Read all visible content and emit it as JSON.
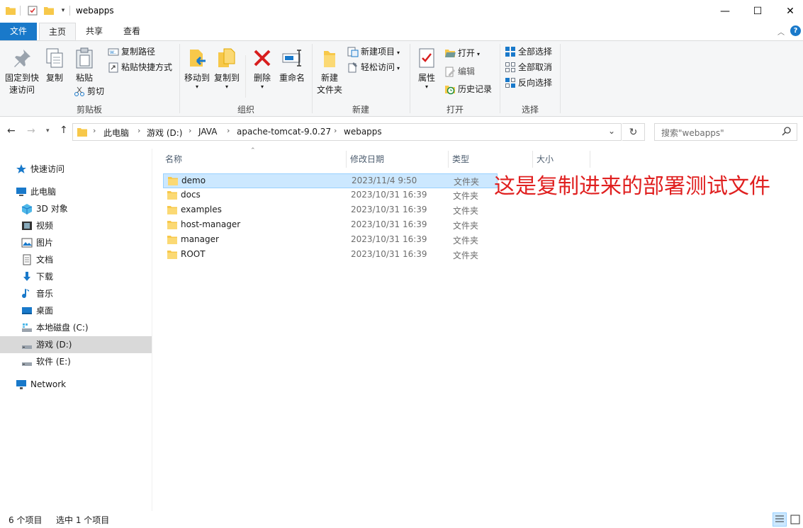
{
  "window": {
    "title": "webapps",
    "minimize_glyph": "—",
    "maximize_glyph": "☐",
    "close_glyph": "✕"
  },
  "ribbon_tabs": {
    "file": "文件",
    "home": "主页",
    "share": "共享",
    "view": "查看"
  },
  "ribbon": {
    "clipboard": {
      "pin": "固定到快",
      "pin2": "速访问",
      "copy": "复制",
      "paste": "粘贴",
      "copy_path": "复制路径",
      "paste_shortcut": "粘贴快捷方式",
      "cut": "剪切",
      "label": "剪贴板"
    },
    "organize": {
      "move_to": "移动到",
      "copy_to": "复制到",
      "delete": "删除",
      "rename": "重命名",
      "label": "组织"
    },
    "new": {
      "new_folder": "新建",
      "new_folder2": "文件夹",
      "new_item": "新建项目",
      "easy_access": "轻松访问",
      "label": "新建"
    },
    "open": {
      "properties": "属性",
      "open": "打开",
      "edit": "编辑",
      "history": "历史记录",
      "label": "打开"
    },
    "select": {
      "select_all": "全部选择",
      "select_none": "全部取消",
      "invert": "反向选择",
      "label": "选择"
    }
  },
  "address": {
    "crumbs": [
      "此电脑",
      "游戏 (D:)",
      "JAVA",
      "apache-tomcat-9.0.27",
      "webapps"
    ],
    "search_placeholder": "搜索\"webapps\""
  },
  "nav": {
    "quick_access": "快速访问",
    "this_pc": "此电脑",
    "objects3d": "3D 对象",
    "videos": "视频",
    "pictures": "图片",
    "documents": "文档",
    "downloads": "下载",
    "music": "音乐",
    "desktop": "桌面",
    "drive_c": "本地磁盘 (C:)",
    "drive_d": "游戏 (D:)",
    "drive_e": "软件 (E:)",
    "network": "Network"
  },
  "columns": {
    "name": "名称",
    "date": "修改日期",
    "type": "类型",
    "size": "大小"
  },
  "files": [
    {
      "name": "demo",
      "date": "2023/11/4 9:50",
      "type": "文件夹",
      "selected": true
    },
    {
      "name": "docs",
      "date": "2023/10/31 16:39",
      "type": "文件夹"
    },
    {
      "name": "examples",
      "date": "2023/10/31 16:39",
      "type": "文件夹"
    },
    {
      "name": "host-manager",
      "date": "2023/10/31 16:39",
      "type": "文件夹"
    },
    {
      "name": "manager",
      "date": "2023/10/31 16:39",
      "type": "文件夹"
    },
    {
      "name": "ROOT",
      "date": "2023/10/31 16:39",
      "type": "文件夹"
    }
  ],
  "annotation": "这是复制进来的部署测试文件",
  "status": {
    "item_count": "6 个项目",
    "selected": "选中 1 个项目"
  },
  "colors": {
    "accent": "#1979ca",
    "selection": "#cce8ff",
    "folder": "#f7c84a",
    "annotation": "#e02020"
  }
}
